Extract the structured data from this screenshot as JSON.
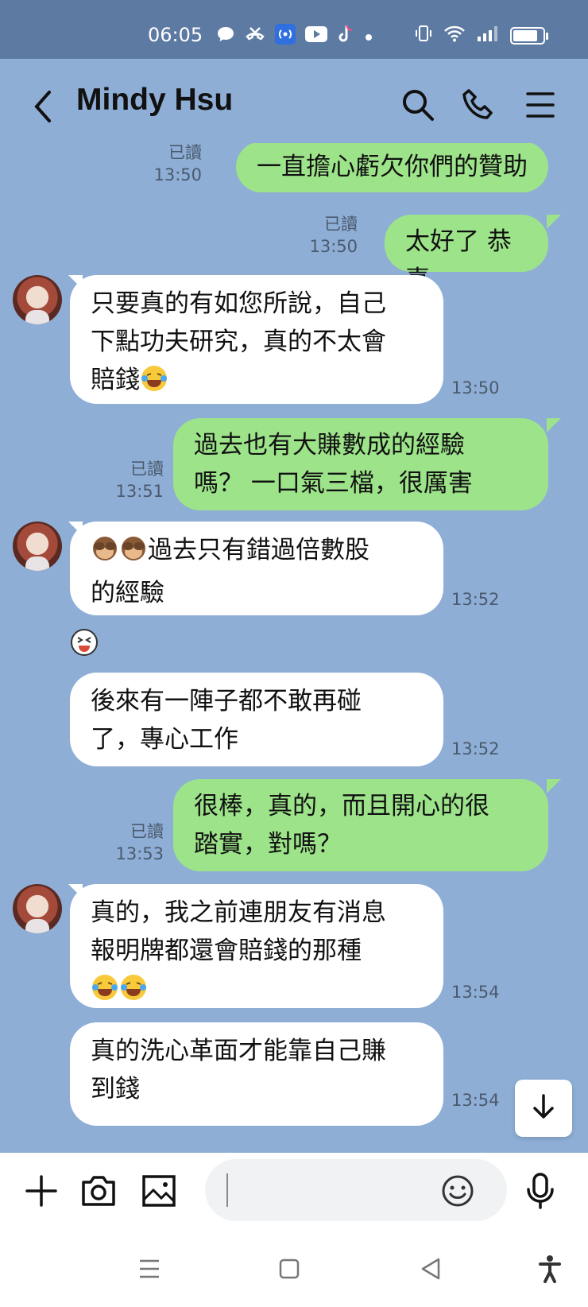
{
  "status_bar": {
    "time": "06:05",
    "battery_level": 0.85
  },
  "header": {
    "contact_name": "Mindy Hsu"
  },
  "messages": [
    {
      "side": "out",
      "text": "一直擔心虧欠你們的贊助",
      "read": "已讀",
      "time": "13:50"
    },
    {
      "side": "out",
      "text": "太好了 恭喜",
      "read": "已讀",
      "time": "13:50"
    },
    {
      "side": "in",
      "line1": "只要真的有如您所說，自己",
      "line2": "下點功夫研究，真的不太會",
      "line3": "賠錢",
      "time": "13:50"
    },
    {
      "side": "out",
      "line1": "過去也有大賺數成的經驗",
      "line2": "嗎？ 一口氣三檔，很厲害",
      "read": "已讀",
      "time": "13:51"
    },
    {
      "side": "in",
      "line1": "過去只有錯過倍數股",
      "line2": "的經驗",
      "time": "13:52"
    },
    {
      "side": "in",
      "line1": "後來有一陣子都不敢再碰",
      "line2": "了，專心工作",
      "time": "13:52"
    },
    {
      "side": "out",
      "line1": "很棒，真的，而且開心的很",
      "line2": "踏實，對嗎？",
      "read": "已讀",
      "time": "13:53"
    },
    {
      "side": "in",
      "line1": "真的，我之前連朋友有消息",
      "line2": "報明牌都還會賠錢的那種",
      "time": "13:54"
    },
    {
      "side": "in",
      "line1": "真的洗心革面才能靠自己賺",
      "line2": "到錢",
      "time": "13:54"
    }
  ],
  "input": {
    "placeholder": ""
  },
  "colors": {
    "chat_bg": "#8eaed6",
    "outgoing_bubble": "#9de38a",
    "incoming_bubble": "#ffffff",
    "status_bar": "#5d7aa3"
  },
  "icons": [
    "back-icon",
    "search-icon",
    "phone-icon",
    "menu-icon",
    "plus-icon",
    "camera-icon",
    "image-icon",
    "emoji-icon",
    "microphone-icon",
    "scroll-down-icon",
    "nav-menu-icon",
    "nav-home-icon",
    "nav-back-icon",
    "accessibility-icon"
  ]
}
